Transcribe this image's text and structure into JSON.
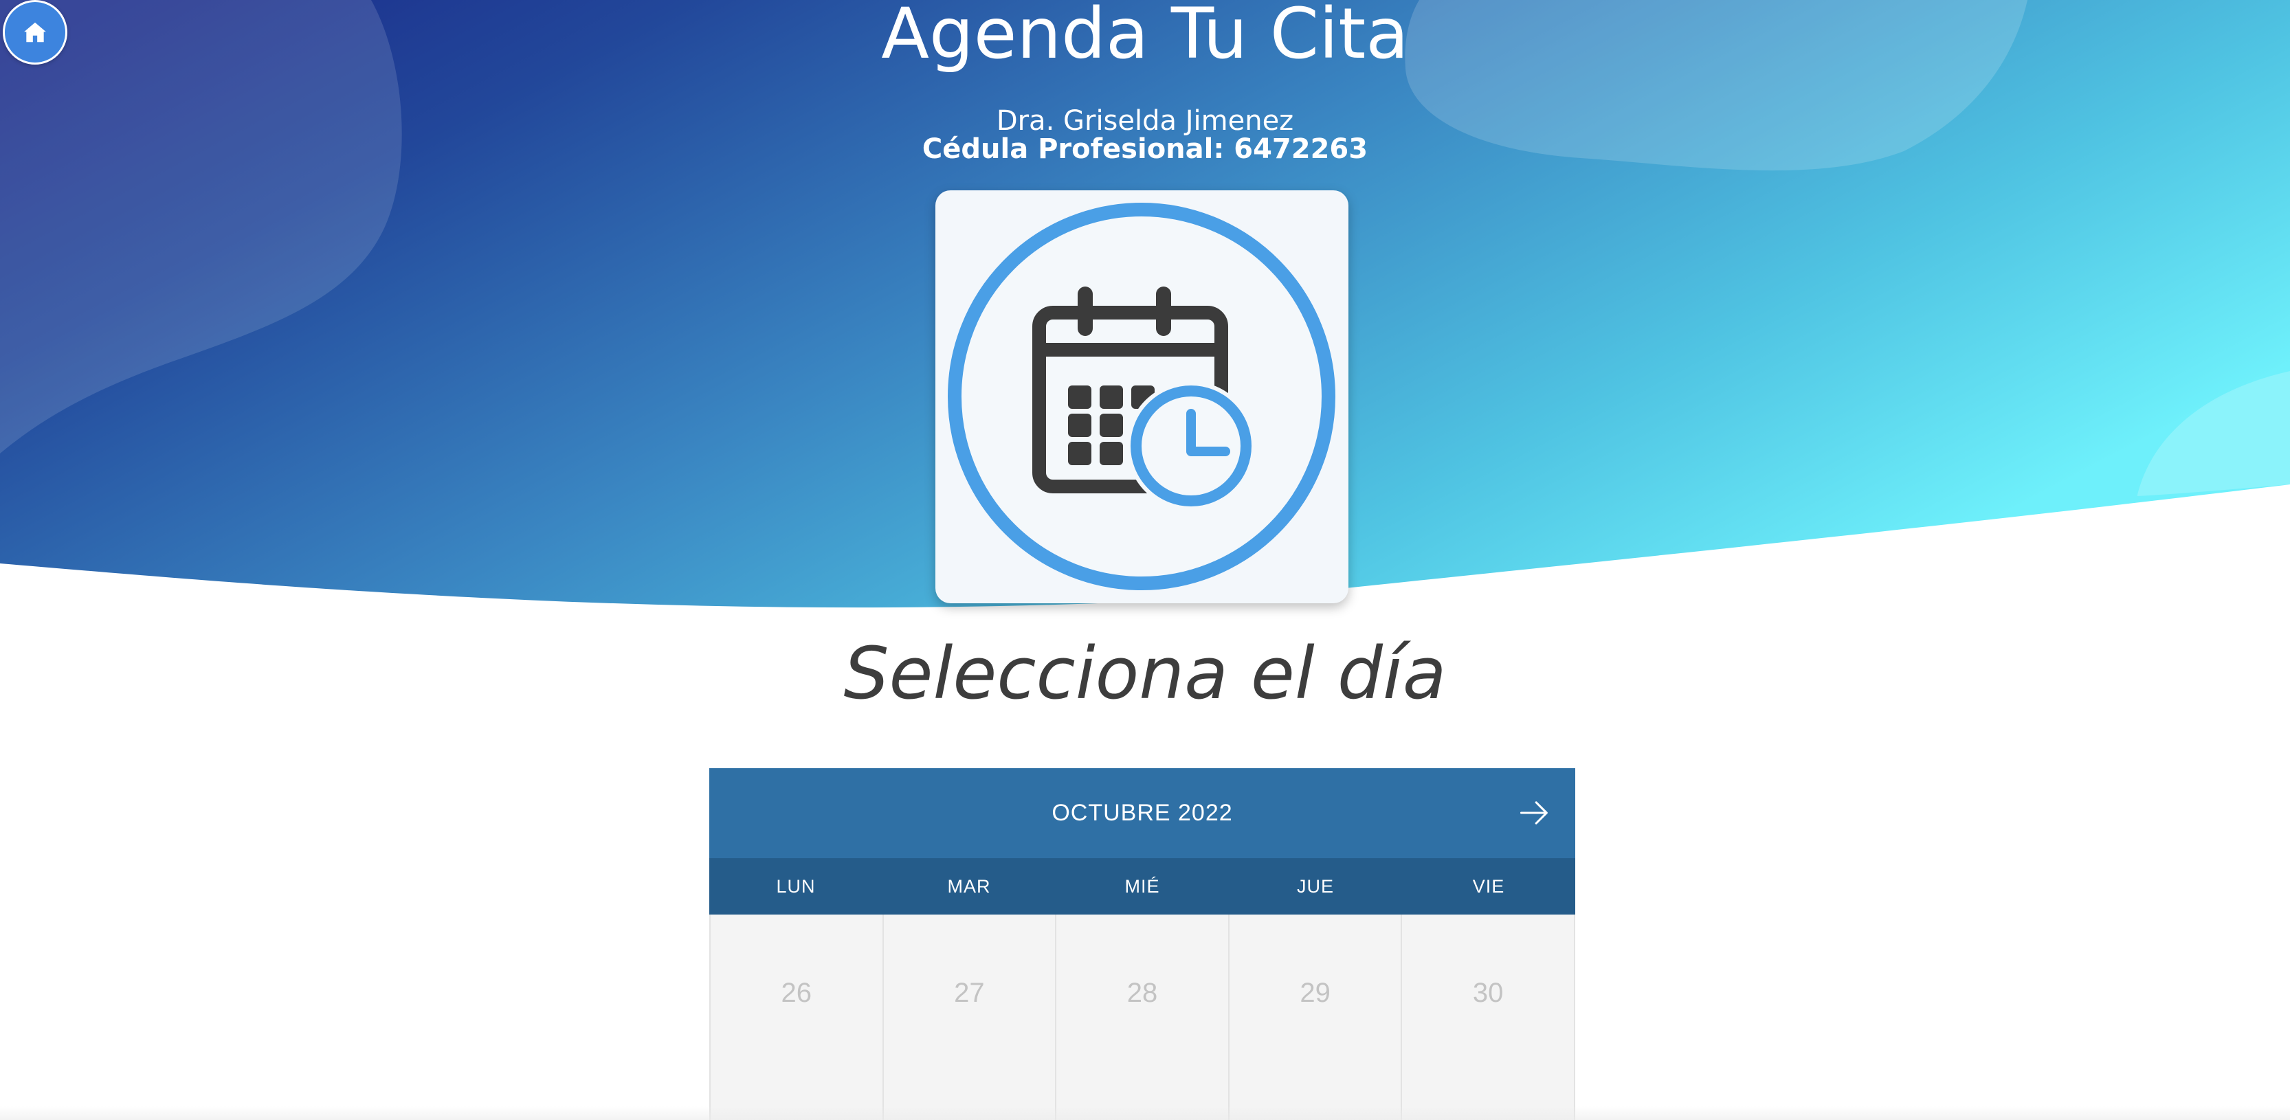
{
  "header": {
    "title": "Agenda Tu Cita",
    "doctor_name": "Dra. Griselda Jimenez",
    "cedula": "Cédula Profesional: 6472263",
    "home_icon": "home-icon",
    "logo_icon": "calendar-clock-icon"
  },
  "main": {
    "section_title": "Selecciona el día"
  },
  "calendar": {
    "month_label": "OCTUBRE 2022",
    "next_icon": "arrow-right-icon",
    "weekdays": [
      "LUN",
      "MAR",
      "MIÉ",
      "JUE",
      "VIE"
    ],
    "days": [
      "26",
      "27",
      "28",
      "29",
      "30"
    ]
  },
  "colors": {
    "gradient_start": "#1b2c8a",
    "gradient_mid": "#3a86c2",
    "gradient_end": "#6ef0fb",
    "calendar_header": "#2f70a5",
    "calendar_weekdays": "#255c8a",
    "accent_blue": "#4a9fe6",
    "home_button": "#3d84de"
  }
}
